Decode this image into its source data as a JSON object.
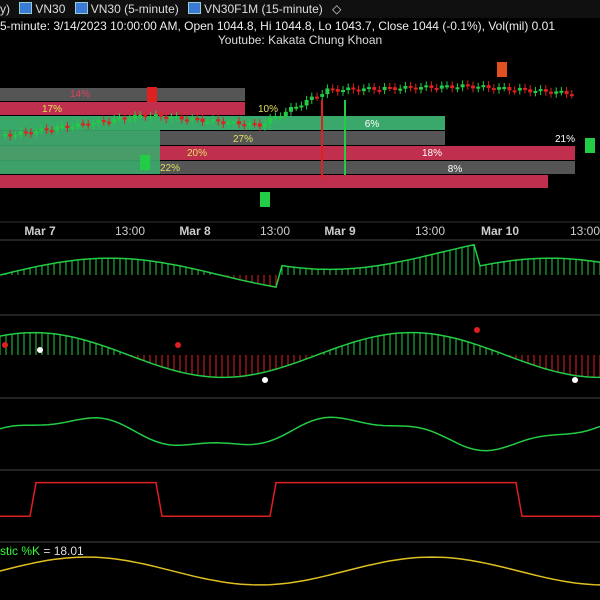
{
  "tabs": [
    {
      "label": "y)"
    },
    {
      "label": "VN30"
    },
    {
      "label": "VN30 (5-minute)"
    },
    {
      "label": "VN30F1M (15-minute)"
    },
    {
      "label": "◇"
    }
  ],
  "info_line": "5-minute: 3/14/2023 10:00:00 AM, Open 1044.8, Hi 1044.8, Lo 1043.7, Close 1044 (-0.1%), Vol(mil) 0.01",
  "subtitle": "Youtube: Kakata Chung Khoan",
  "date_axis": [
    {
      "label": "Mar 7",
      "bold": true
    },
    {
      "label": "13:00",
      "bold": false
    },
    {
      "label": "Mar 8",
      "bold": true
    },
    {
      "label": "13:00",
      "bold": false
    },
    {
      "label": "Mar 9",
      "bold": true
    },
    {
      "label": "13:00",
      "bold": false
    },
    {
      "label": "Mar 10",
      "bold": true
    },
    {
      "label": "13:00",
      "bold": false
    }
  ],
  "volume_profile": [
    {
      "label": "14%",
      "color": "#e04060"
    },
    {
      "label": "17%",
      "color": "#e0e060"
    },
    {
      "label": "10%",
      "color": "#e0e060"
    },
    {
      "label": "6%",
      "color": "#ffffff"
    },
    {
      "label": "27%",
      "color": "#e0e060"
    },
    {
      "label": "21%",
      "color": "#ffffff"
    },
    {
      "label": "20%",
      "color": "#e0e060"
    },
    {
      "label": "18%",
      "color": "#ffffff"
    },
    {
      "label": "22%",
      "color": "#e0e060"
    },
    {
      "label": "8%",
      "color": "#ffffff"
    }
  ],
  "stochastic": {
    "name": "stic %K",
    "separator": " = ",
    "value": "18.01"
  },
  "colors": {
    "up": "#22cc44",
    "down": "#e02020",
    "profile_green": "#3aa86a",
    "profile_red": "#c0304e",
    "profile_gray": "#555555"
  }
}
